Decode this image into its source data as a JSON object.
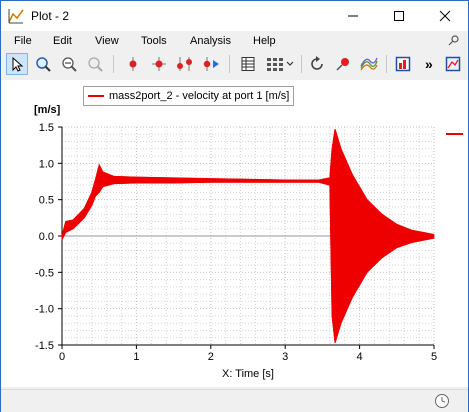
{
  "window": {
    "title": "Plot - 2",
    "buttons": {
      "minimize": "—",
      "maximize": "☐",
      "close": "✕"
    }
  },
  "menu": [
    "File",
    "Edit",
    "View",
    "Tools",
    "Analysis",
    "Help"
  ],
  "toolbar": {
    "icons": [
      "select-arrow-icon",
      "zoom-icon",
      "zoom-out-icon",
      "zoom-fit-icon",
      "marker-icon",
      "crosshair-marker-icon",
      "two-markers-icon",
      "marker-play-icon",
      "table-icon",
      "grid-layout-icon",
      "refresh-icon",
      "pin-icon",
      "curves-icon",
      "plot-export-icon",
      "more-icon",
      "save-plot-icon"
    ],
    "overflow_label": "»"
  },
  "legend": {
    "entry": "mass2port_2 - velocity at port 1 [m/s]",
    "color": "#ee0000"
  },
  "chart_data": {
    "type": "line",
    "ylabel": "[m/s]",
    "xlabel": "X: Time [s]",
    "xlim": [
      0,
      5
    ],
    "ylim": [
      -1.5,
      1.5
    ],
    "xticks": [
      "0",
      "1",
      "2",
      "3",
      "4",
      "5"
    ],
    "yticks": [
      "1.5",
      "1.0",
      "0.5",
      "0.0",
      "-0.5",
      "-1.0",
      "-1.5"
    ],
    "grid": true,
    "series": [
      {
        "name": "mass2port_2 - velocity at port 1 [m/s]",
        "color": "#ee0000",
        "oscillating": true,
        "upper": [
          [
            0,
            0.0
          ],
          [
            0.05,
            0.2
          ],
          [
            0.15,
            0.22
          ],
          [
            0.3,
            0.38
          ],
          [
            0.4,
            0.6
          ],
          [
            0.45,
            0.78
          ],
          [
            0.5,
            0.98
          ],
          [
            0.55,
            0.88
          ],
          [
            0.7,
            0.82
          ],
          [
            1.0,
            0.81
          ],
          [
            1.5,
            0.8
          ],
          [
            2.0,
            0.79
          ],
          [
            2.5,
            0.78
          ],
          [
            3.0,
            0.77
          ],
          [
            3.45,
            0.77
          ],
          [
            3.6,
            0.8
          ],
          [
            3.63,
            1.2
          ],
          [
            3.67,
            1.47
          ],
          [
            3.75,
            1.2
          ],
          [
            3.9,
            0.85
          ],
          [
            4.1,
            0.5
          ],
          [
            4.3,
            0.3
          ],
          [
            4.5,
            0.16
          ],
          [
            4.7,
            0.08
          ],
          [
            5.0,
            0.02
          ]
        ],
        "lower": [
          [
            0,
            -0.05
          ],
          [
            0.05,
            0.05
          ],
          [
            0.15,
            0.1
          ],
          [
            0.3,
            0.25
          ],
          [
            0.4,
            0.42
          ],
          [
            0.45,
            0.55
          ],
          [
            0.5,
            0.6
          ],
          [
            0.55,
            0.68
          ],
          [
            0.7,
            0.72
          ],
          [
            1.0,
            0.73
          ],
          [
            1.5,
            0.73
          ],
          [
            2.0,
            0.74
          ],
          [
            2.5,
            0.74
          ],
          [
            3.0,
            0.74
          ],
          [
            3.45,
            0.74
          ],
          [
            3.6,
            0.7
          ],
          [
            3.63,
            -1.1
          ],
          [
            3.67,
            -1.47
          ],
          [
            3.75,
            -1.2
          ],
          [
            3.9,
            -0.85
          ],
          [
            4.1,
            -0.5
          ],
          [
            4.3,
            -0.3
          ],
          [
            4.5,
            -0.16
          ],
          [
            4.7,
            -0.09
          ],
          [
            5.0,
            -0.03
          ]
        ]
      }
    ]
  },
  "status": {
    "clock_icon": "clock-icon"
  }
}
